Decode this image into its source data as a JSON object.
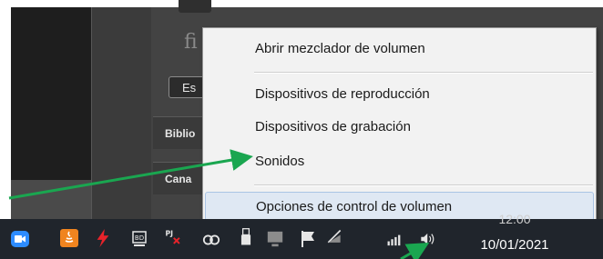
{
  "background_app": {
    "logo_text": "fi",
    "search_button_label": "Es",
    "nav_items": [
      "Biblio",
      "Cana"
    ]
  },
  "context_menu": {
    "items": [
      {
        "label": "Abrir mezclador de volumen"
      },
      {
        "label": "Dispositivos de reproducción"
      },
      {
        "label": "Dispositivos de grabación"
      },
      {
        "label": "Sonidos"
      },
      {
        "label": "Opciones de control de volumen",
        "highlighted": true
      }
    ]
  },
  "taskbar": {
    "clock_time": "12:00",
    "clock_date": "10/01/2021",
    "tray_icons": [
      "zoom-icon",
      "java-icon",
      "lightning-icon",
      "chip-icon",
      "crossed-network-icon",
      "link-icon",
      "usb-icon",
      "monitor-icon",
      "flag-icon",
      "wifi-off-icon",
      "signal-bars-icon",
      "speaker-icon"
    ]
  },
  "annotation": {
    "arrow_color": "#1aa650"
  },
  "colors": {
    "menu_background": "#f2f2f2",
    "menu_highlight": "#dfe8f3",
    "taskbar": "#20252c"
  }
}
